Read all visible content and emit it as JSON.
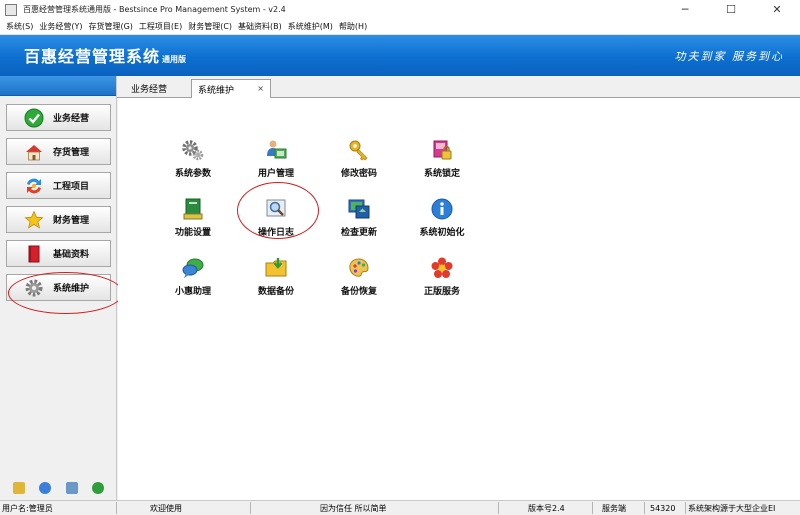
{
  "window": {
    "title": "百惠经营管理系统通用版 - Bestsince Pro Management System - v2.4",
    "min_symbol": "─",
    "max_symbol": "☐",
    "close_symbol": "✕"
  },
  "menu": [
    "系统(S)",
    "业务经营(Y)",
    "存货管理(G)",
    "工程项目(E)",
    "财务管理(C)",
    "基础资料(B)",
    "系统维护(M)",
    "帮助(H)"
  ],
  "banner": {
    "title": "百惠经营管理系统",
    "edition": "通用版",
    "slogan": "功夫到家 服务到心"
  },
  "sidebar": {
    "items": [
      {
        "label": "业务经营",
        "icon": "check-circle-icon"
      },
      {
        "label": "存货管理",
        "icon": "house-icon"
      },
      {
        "label": "工程项目",
        "icon": "cycle-arrows-icon"
      },
      {
        "label": "财务管理",
        "icon": "star-icon"
      },
      {
        "label": "基础资料",
        "icon": "red-book-icon"
      },
      {
        "label": "系统维护",
        "icon": "gear-icon"
      }
    ]
  },
  "tabs": [
    {
      "label": "业务经营",
      "active": false
    },
    {
      "label": "系统维护",
      "active": true,
      "close": "×"
    }
  ],
  "modules": [
    {
      "label": "系统参数",
      "icon": "gears-icon"
    },
    {
      "label": "用户管理",
      "icon": "users-icon"
    },
    {
      "label": "修改密码",
      "icon": "key-icon"
    },
    {
      "label": "系统锁定",
      "icon": "lock-icon"
    },
    {
      "label": "功能设置",
      "icon": "book-settings-icon"
    },
    {
      "label": "操作日志",
      "icon": "magnifier-log-icon"
    },
    {
      "label": "检查更新",
      "icon": "update-icon"
    },
    {
      "label": "系统初始化",
      "icon": "info-icon"
    },
    {
      "label": "小惠助理",
      "icon": "chat-icon"
    },
    {
      "label": "数据备份",
      "icon": "folder-download-icon"
    },
    {
      "label": "备份恢复",
      "icon": "palette-icon"
    },
    {
      "label": "正版服务",
      "icon": "flower-icon"
    }
  ],
  "status": {
    "user": "用户名:管理员",
    "welcome": "欢迎使用",
    "motto": "因为信任 所以简单",
    "version": "版本号2.4",
    "server": "服务端",
    "port": "54320",
    "arch": "系统架构源于大型企业EI"
  },
  "colors": {
    "banner": "#0d6fd0",
    "annotation": "#d41c1c"
  }
}
